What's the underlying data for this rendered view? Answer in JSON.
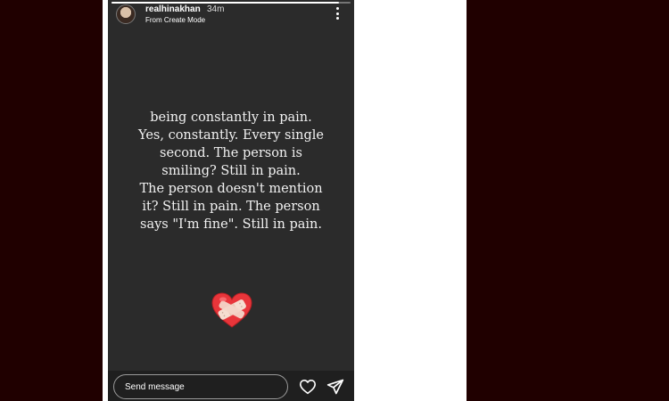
{
  "story": {
    "username": "realhinakhan",
    "time": "34m",
    "subtitle": "From Create Mode",
    "progress": 0.95,
    "text_lines": [
      "being constantly in pain.",
      "Yes, constantly. Every single",
      "second. The person is",
      "smiling? Still in pain.",
      "The person doesn't mention",
      "it? Still in pain. The person",
      "says \"I'm fine\". Still in pain."
    ],
    "sticker": "mending-heart-icon"
  },
  "reply": {
    "placeholder": "Send message"
  },
  "icons": {
    "more": "more-vertical-icon",
    "like": "heart-outline-icon",
    "send": "paper-plane-icon"
  },
  "colors": {
    "page_background": "#200000",
    "frame": "#ffffff",
    "story_background": "#2b2b2b",
    "text": "#f2f2f2",
    "heart_red": "#e8353a",
    "bandage": "#f5ddd0"
  }
}
